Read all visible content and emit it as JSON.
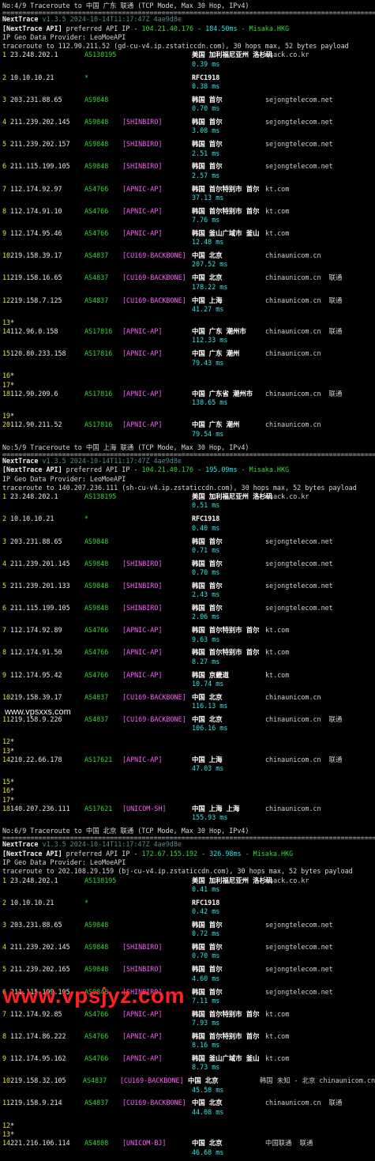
{
  "sections": [
    {
      "header": "No:4/9 Traceroute to 中国 广东 联通 (TCP Mode, Max 30 Hop, IPv4)",
      "app": "NextTrace",
      "version": "v1.3.5 2024-10-14T11:17:47Z 4ae9d8e",
      "api_prefix": "[NextTrace API]",
      "api_mid": " preferred API IP - ",
      "api_ip": "104.21.40.176",
      "api_ms": " - 184.50ms",
      "api_node": " - Misaka.HKG",
      "geo": "IP Geo Data Provider: LeoMoeAPI",
      "target": "traceroute to 112.90.211.52 (gd-cu-v4.ip.zstaticcdn.com), 30 hops max, 52 bytes payload",
      "hops": [
        {
          "n": "1",
          "ip": "23.248.202.1",
          "as": "AS138195",
          "tag": "",
          "geo": "美国 加利福尼亚州 洛杉矶",
          "org": "moack.co.kr",
          "lat": "0.39 ms"
        },
        {
          "n": "2",
          "ip": "10.10.10.21",
          "as": "*",
          "tag": "",
          "geo": "RFC1918",
          "org": "",
          "lat": "0.38 ms"
        },
        {
          "n": "3",
          "ip": "203.231.88.65",
          "as": "AS9848",
          "tag": "",
          "geo": "韩国 首尔",
          "org": "sejongtelecom.net",
          "lat": "0.70 ms"
        },
        {
          "n": "4",
          "ip": "211.239.202.145",
          "as": "AS9848",
          "tag": "[SHINBIRO]",
          "geo": "韩国 首尔",
          "org": "sejongtelecom.net",
          "lat": "3.08 ms"
        },
        {
          "n": "5",
          "ip": "211.239.202.157",
          "as": "AS9848",
          "tag": "[SHINBIRO]",
          "geo": "韩国 首尔",
          "org": "sejongtelecom.net",
          "lat": "2.51 ms"
        },
        {
          "n": "6",
          "ip": "211.115.199.105",
          "as": "AS9848",
          "tag": "[SHINBIRO]",
          "geo": "韩国 首尔",
          "org": "sejongtelecom.net",
          "lat": "2.57 ms"
        },
        {
          "n": "7",
          "ip": "112.174.92.97",
          "as": "AS4766",
          "tag": "[APNIC-AP]",
          "geo": "韩国 首尔特别市 首尔",
          "org": "kt.com",
          "lat": "37.13 ms"
        },
        {
          "n": "8",
          "ip": "112.174.91.10",
          "as": "AS4766",
          "tag": "[APNIC-AP]",
          "geo": "韩国 首尔特别市 首尔",
          "org": "kt.com",
          "lat": "7.76 ms"
        },
        {
          "n": "9",
          "ip": "112.174.95.46",
          "as": "AS4766",
          "tag": "[APNIC-AP]",
          "geo": "韩国 釜山广域市 釜山",
          "org": "kt.com",
          "lat": "12.48 ms"
        },
        {
          "n": "10",
          "ip": "219.158.39.17",
          "as": "AS4837",
          "tag": "[CU169-BACKBONE]",
          "geo": "中国 北京",
          "org": "chinaunicom.cn",
          "lat": "207.52 ms"
        },
        {
          "n": "11",
          "ip": "219.158.16.65",
          "as": "AS4837",
          "tag": "[CU169-BACKBONE]",
          "geo": "中国 北京",
          "org": "chinaunicom.cn  联通",
          "lat": "178.22 ms"
        },
        {
          "n": "12",
          "ip": "219.158.7.125",
          "as": "AS4837",
          "tag": "[CU169-BACKBONE]",
          "geo": "中国 上海",
          "org": "chinaunicom.cn  联通",
          "lat": "41.27 ms"
        },
        {
          "n": "13",
          "ip": "*"
        },
        {
          "n": "14",
          "ip": "112.96.0.158",
          "as": "AS17816",
          "tag": "[APNIC-AP]",
          "geo": "中国 广东 潮州市",
          "org": "chinaunicom.cn  联通",
          "lat": "112.33 ms"
        },
        {
          "n": "15",
          "ip": "120.80.233.158",
          "as": "AS17816",
          "tag": "[APNIC-AP]",
          "geo": "中国 广东 潮州",
          "org": "chinaunicom.cn",
          "lat": "79.43 ms"
        },
        {
          "n": "16",
          "ip": "*"
        },
        {
          "n": "17",
          "ip": "*"
        },
        {
          "n": "18",
          "ip": "112.90.209.6",
          "as": "AS17816",
          "tag": "[APNIC-AP]",
          "geo": "中国 广东省 潮州市",
          "org": "chinaunicom.cn  联通",
          "lat": "138.65 ms"
        },
        {
          "n": "19",
          "ip": "*"
        },
        {
          "n": "20",
          "ip": "112.90.211.52",
          "as": "AS17816",
          "tag": "[APNIC-AP]",
          "geo": "中国 广东 潮州",
          "org": "chinaunicom.cn",
          "lat": "79.54 ms"
        }
      ]
    },
    {
      "header": "No:5/9 Traceroute to 中国 上海 联通 (TCP Mode, Max 30 Hop, IPv4)",
      "app": "NextTrace",
      "version": "v1.3.5 2024-10-14T11:17:47Z 4ae9d8e",
      "api_prefix": "[NextTrace API]",
      "api_mid": " preferred API IP - ",
      "api_ip": "104.21.40.176",
      "api_ms": " - 195.09ms",
      "api_node": " - Misaka.HKG",
      "geo": "IP Geo Data Provider: LeoMoeAPI",
      "target": "traceroute to 140.207.236.111 (sh-cu-v4.ip.zstaticcdn.com), 30 hops max, 52 bytes payload",
      "hops": [
        {
          "n": "1",
          "ip": "23.248.202.1",
          "as": "AS138195",
          "tag": "",
          "geo": "美国 加利福尼亚州 洛杉矶",
          "org": "moack.co.kr",
          "lat": "0.51 ms"
        },
        {
          "n": "2",
          "ip": "10.10.10.21",
          "as": "*",
          "tag": "",
          "geo": "RFC1918",
          "org": "",
          "lat": "0.40 ms"
        },
        {
          "n": "3",
          "ip": "203.231.88.65",
          "as": "AS9848",
          "tag": "",
          "geo": "韩国 首尔",
          "org": "sejongtelecom.net",
          "lat": "0.71 ms"
        },
        {
          "n": "4",
          "ip": "211.239.201.145",
          "as": "AS9848",
          "tag": "[SHINBIRO]",
          "geo": "韩国 首尔",
          "org": "sejongtelecom.net",
          "lat": "0.70 ms"
        },
        {
          "n": "5",
          "ip": "211.239.201.133",
          "as": "AS9848",
          "tag": "[SHINBIRO]",
          "geo": "韩国 首尔",
          "org": "sejongtelecom.net",
          "lat": "2.43 ms"
        },
        {
          "n": "6",
          "ip": "211.115.199.105",
          "as": "AS9848",
          "tag": "[SHINBIRO]",
          "geo": "韩国 首尔",
          "org": "sejongtelecom.net",
          "lat": "2.06 ms"
        },
        {
          "n": "7",
          "ip": "112.174.92.89",
          "as": "AS4766",
          "tag": "[APNIC-AP]",
          "geo": "韩国 首尔特别市 首尔",
          "org": "kt.com",
          "lat": "9.63 ms"
        },
        {
          "n": "8",
          "ip": "112.174.91.50",
          "as": "AS4766",
          "tag": "[APNIC-AP]",
          "geo": "韩国 首尔特别市 首尔",
          "org": "kt.com",
          "lat": "8.27 ms"
        },
        {
          "n": "9",
          "ip": "112.174.95.42",
          "as": "AS4766",
          "tag": "[APNIC-AP]",
          "geo": "韩国 京畿道",
          "org": "kt.com",
          "lat": "10.74 ms"
        },
        {
          "n": "10",
          "ip": "219.158.39.17",
          "as": "AS4837",
          "tag": "[CU169-BACKBONE]",
          "geo": "中国 北京",
          "org": "chinaunicom.cn",
          "lat": "116.13 ms"
        },
        {
          "n": "11",
          "ip": "219.158.9.226",
          "as": "AS4837",
          "tag": "[CU169-BACKBONE]",
          "geo": "中国 北京",
          "org": "chinaunicom.cn  联通",
          "lat": "106.16 ms"
        },
        {
          "n": "12",
          "ip": "*"
        },
        {
          "n": "13",
          "ip": "*"
        },
        {
          "n": "14",
          "ip": "210.22.66.178",
          "as": "AS17621",
          "tag": "[APNIC-AP]",
          "geo": "中国 上海",
          "org": "chinaunicom.cn  联通",
          "lat": "47.03 ms"
        },
        {
          "n": "15",
          "ip": "*"
        },
        {
          "n": "16",
          "ip": "*"
        },
        {
          "n": "17",
          "ip": "*"
        },
        {
          "n": "18",
          "ip": "140.207.236.111",
          "as": "AS17621",
          "tag": "[UNICOM-SH]",
          "geo": "中国 上海 上海",
          "org": "chinaunicom.cn",
          "lat": "155.93 ms"
        }
      ]
    },
    {
      "header": "No:6/9 Traceroute to 中国 北京 联通 (TCP Mode, Max 30 Hop, IPv4)",
      "app": "NextTrace",
      "version": "v1.3.5 2024-10-14T11:17:47Z 4ae9d8e",
      "api_prefix": "[NextTrace API]",
      "api_mid": " preferred API IP - ",
      "api_ip": "172.67.155.192",
      "api_ms": " - 326.98ms",
      "api_node": " - Misaka.HKG",
      "geo": "IP Geo Data Provider: LeoMoeAPI",
      "target": "traceroute to 202.108.29.159 (bj-cu-v4.ip.zstaticcdn.com), 30 hops max, 52 bytes payload",
      "hops": [
        {
          "n": "1",
          "ip": "23.248.202.1",
          "as": "AS138195",
          "tag": "",
          "geo": "美国 加利福尼亚州 洛杉矶",
          "org": "moack.co.kr",
          "lat": "0.41 ms"
        },
        {
          "n": "2",
          "ip": "10.10.10.21",
          "as": "*",
          "tag": "",
          "geo": "RFC1918",
          "org": "",
          "lat": "0.42 ms"
        },
        {
          "n": "3",
          "ip": "203.231.88.65",
          "as": "AS9848",
          "tag": "",
          "geo": "韩国 首尔",
          "org": "sejongtelecom.net",
          "lat": "0.72 ms"
        },
        {
          "n": "4",
          "ip": "211.239.202.145",
          "as": "AS9848",
          "tag": "[SHINBIRO]",
          "geo": "韩国 首尔",
          "org": "sejongtelecom.net",
          "lat": "0.70 ms"
        },
        {
          "n": "5",
          "ip": "211.239.202.165",
          "as": "AS9848",
          "tag": "[SHINBIRO]",
          "geo": "韩国 首尔",
          "org": "sejongtelecom.net",
          "lat": "4.60 ms"
        },
        {
          "n": "6",
          "ip": "211.115.199.105",
          "as": "AS9848",
          "tag": "[SHINBIRO]",
          "geo": "韩国 首尔",
          "org": "sejongtelecom.net",
          "lat": "7.11 ms"
        },
        {
          "n": "7",
          "ip": "112.174.92.85",
          "as": "AS4766",
          "tag": "[APNIC-AP]",
          "geo": "韩国 首尔特别市 首尔",
          "org": "kt.com",
          "lat": "7.93 ms"
        },
        {
          "n": "8",
          "ip": "112.174.86.222",
          "as": "AS4766",
          "tag": "[APNIC-AP]",
          "geo": "韩国 首尔特别市 首尔",
          "org": "kt.com",
          "lat": "8.16 ms"
        },
        {
          "n": "9",
          "ip": "112.174.95.162",
          "as": "AS4766",
          "tag": "[APNIC-AP]",
          "geo": "韩国 釜山广域市 釜山",
          "org": "kt.com",
          "lat": "8.73 ms"
        },
        {
          "n": "10",
          "ip": "219.158.32.105",
          "as": "AS4837",
          "tag": "[CU169-BACKBONE]",
          "geo": "中国 北京",
          "org": "韩国 未知 - 北京 chinaunicom.cn",
          "lat": "45.58 ms"
        },
        {
          "n": "11",
          "ip": "219.158.9.214",
          "as": "AS4837",
          "tag": "[CU169-BACKBONE]",
          "geo": "中国 北京",
          "org": "chinaunicom.cn  联通",
          "lat": "44.08 ms"
        },
        {
          "n": "12",
          "ip": "*"
        },
        {
          "n": "13",
          "ip": "*"
        },
        {
          "n": "14",
          "ip": "221.216.106.114",
          "as": "AS4808",
          "tag": "[UNICOM-BJ]",
          "geo": "中国 北京",
          "org": "中国联通  联通",
          "lat": "46.68 ms"
        }
      ]
    }
  ],
  "separator": "================================================================================================",
  "watermark_small": "www.vpsxxs.com",
  "watermark_big": "www.vpsjyz.com"
}
